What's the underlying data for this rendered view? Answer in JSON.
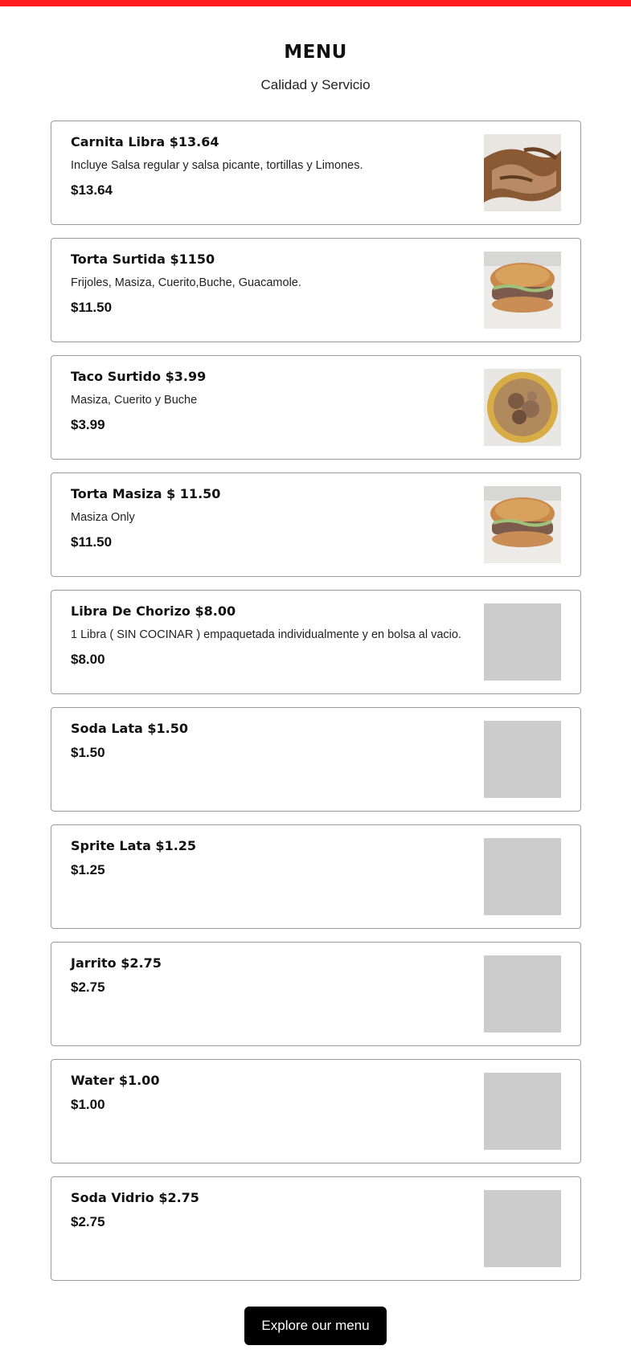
{
  "header": {
    "title": "MENU",
    "subtitle": "Calidad y Servicio"
  },
  "accent_color": "#ff1a1f",
  "placeholder_color": "#cccccc",
  "items": [
    {
      "name": "Carnita Libra $13.64",
      "description": "Incluye Salsa regular y salsa picante, tortillas y Limones.",
      "price": "$13.64",
      "image": "carnitas-photo"
    },
    {
      "name": "Torta Surtida $1150",
      "description": "Frijoles, Masiza, Cuerito,Buche, Guacamole.",
      "price": "$11.50",
      "image": "torta-photo"
    },
    {
      "name": "Taco Surtido $3.99",
      "description": "Masiza, Cuerito y Buche",
      "price": "$3.99",
      "image": "taco-photo"
    },
    {
      "name": "Torta Masiza $ 11.50",
      "description": "Masiza Only",
      "price": "$11.50",
      "image": "torta-photo"
    },
    {
      "name": "Libra De Chorizo $8.00",
      "description": "1 Libra ( SIN COCINAR ) empaquetada individualmente y en bolsa al vacio.",
      "price": "$8.00",
      "image": "placeholder"
    },
    {
      "name": "Soda Lata $1.50",
      "description": "",
      "price": "$1.50",
      "image": "placeholder"
    },
    {
      "name": "Sprite Lata $1.25",
      "description": "",
      "price": "$1.25",
      "image": "placeholder"
    },
    {
      "name": "Jarrito $2.75",
      "description": "",
      "price": "$2.75",
      "image": "placeholder"
    },
    {
      "name": "Water $1.00",
      "description": "",
      "price": "$1.00",
      "image": "placeholder"
    },
    {
      "name": "Soda Vidrio $2.75",
      "description": "",
      "price": "$2.75",
      "image": "placeholder"
    }
  ],
  "cta": {
    "label": "Explore our menu"
  }
}
